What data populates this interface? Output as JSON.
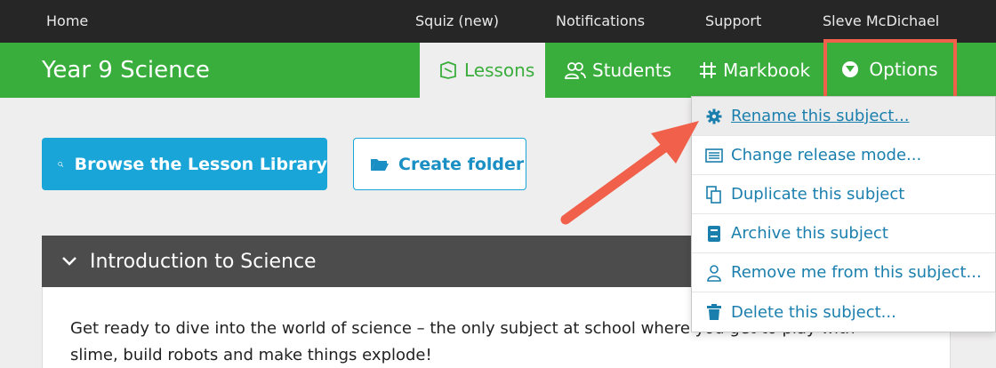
{
  "topnav": {
    "home": "Home",
    "squiz": "Squiz (new)",
    "notifications": "Notifications",
    "support": "Support",
    "user": "Sleve McDichael"
  },
  "subject": {
    "title": "Year 9 Science",
    "tabs": {
      "lessons": "Lessons",
      "students": "Students",
      "markbook": "Markbook",
      "options": "Options"
    }
  },
  "actions": {
    "browse_label": "Browse the Lesson Library",
    "folder_label": "Create folder"
  },
  "unit": {
    "title": "Introduction to Science",
    "description": "Get ready to dive into the world of science – the only subject at school where you get to play with slime, build robots and make things explode!"
  },
  "options_menu": {
    "items": [
      {
        "label": "Rename this subject...",
        "icon": "gear-icon"
      },
      {
        "label": "Change release mode...",
        "icon": "list-icon"
      },
      {
        "label": "Duplicate this subject",
        "icon": "copy-icon"
      },
      {
        "label": "Archive this subject",
        "icon": "archive-icon"
      },
      {
        "label": "Remove me from this subject...",
        "icon": "user-icon"
      },
      {
        "label": "Delete this subject...",
        "icon": "trash-icon"
      }
    ]
  },
  "colors": {
    "brand_green": "#3aae3c",
    "topbar": "#262626",
    "accent_blue": "#1aa5d8",
    "link_blue": "#1b7fae",
    "highlight": "#f0604a"
  }
}
